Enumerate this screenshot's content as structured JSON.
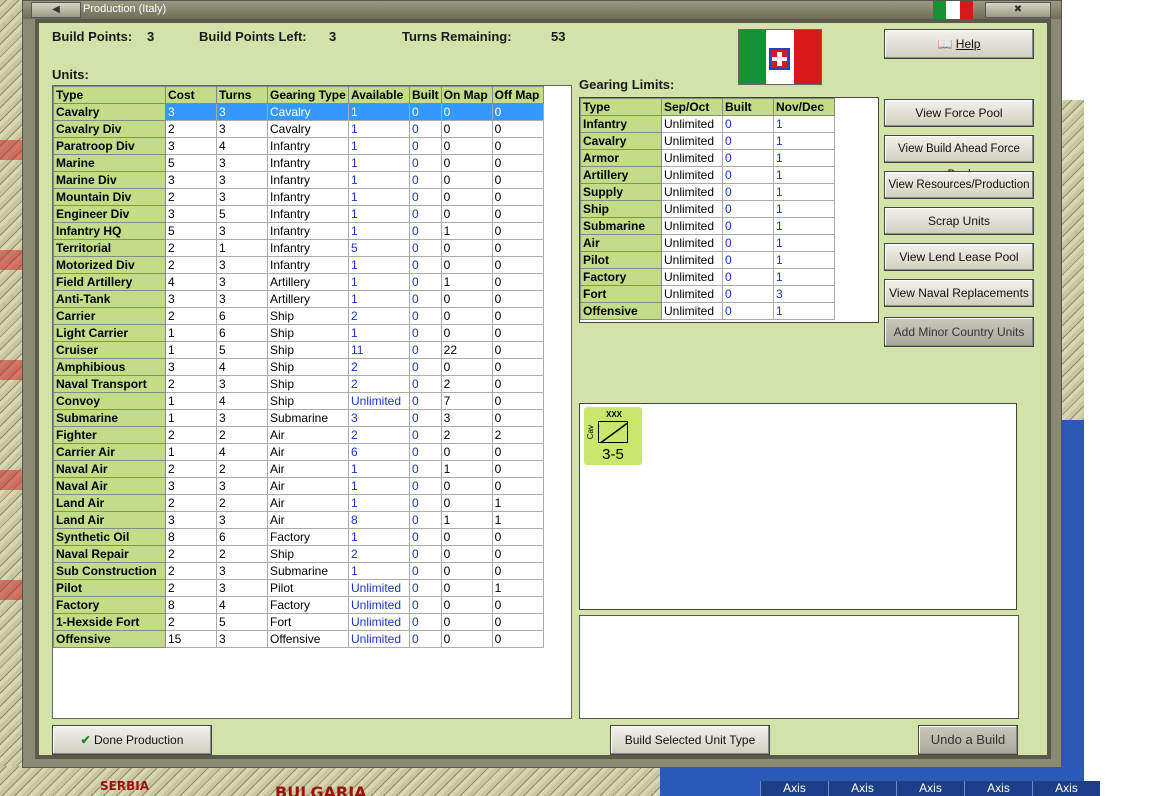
{
  "window": {
    "title": "Production (Italy)"
  },
  "status": {
    "build_points_label": "Build Points:",
    "build_points_value": "3",
    "build_points_left_label": "Build Points Left:",
    "build_points_left_value": "3",
    "turns_remaining_label": "Turns Remaining:",
    "turns_remaining_value": "53"
  },
  "units": {
    "heading": "Units:",
    "columns": [
      "Type",
      "Cost",
      "Turns",
      "Gearing Type",
      "Available",
      "Built",
      "On Map",
      "Off Map"
    ],
    "rows": [
      [
        "Cavalry",
        "3",
        "3",
        "Cavalry",
        "1",
        "0",
        "0",
        "0"
      ],
      [
        "Cavalry Div",
        "2",
        "3",
        "Cavalry",
        "1",
        "0",
        "0",
        "0"
      ],
      [
        "Paratroop Div",
        "3",
        "4",
        "Infantry",
        "1",
        "0",
        "0",
        "0"
      ],
      [
        "Marine",
        "5",
        "3",
        "Infantry",
        "1",
        "0",
        "0",
        "0"
      ],
      [
        "Marine Div",
        "3",
        "3",
        "Infantry",
        "1",
        "0",
        "0",
        "0"
      ],
      [
        "Mountain Div",
        "2",
        "3",
        "Infantry",
        "1",
        "0",
        "0",
        "0"
      ],
      [
        "Engineer Div",
        "3",
        "5",
        "Infantry",
        "1",
        "0",
        "0",
        "0"
      ],
      [
        "Infantry HQ",
        "5",
        "3",
        "Infantry",
        "1",
        "0",
        "1",
        "0"
      ],
      [
        "Territorial",
        "2",
        "1",
        "Infantry",
        "5",
        "0",
        "0",
        "0"
      ],
      [
        "Motorized Div",
        "2",
        "3",
        "Infantry",
        "1",
        "0",
        "0",
        "0"
      ],
      [
        "Field Artillery",
        "4",
        "3",
        "Artillery",
        "1",
        "0",
        "1",
        "0"
      ],
      [
        "Anti-Tank",
        "3",
        "3",
        "Artillery",
        "1",
        "0",
        "0",
        "0"
      ],
      [
        "Carrier",
        "2",
        "6",
        "Ship",
        "2",
        "0",
        "0",
        "0"
      ],
      [
        "Light Carrier",
        "1",
        "6",
        "Ship",
        "1",
        "0",
        "0",
        "0"
      ],
      [
        "Cruiser",
        "1",
        "5",
        "Ship",
        "11",
        "0",
        "22",
        "0"
      ],
      [
        "Amphibious",
        "3",
        "4",
        "Ship",
        "2",
        "0",
        "0",
        "0"
      ],
      [
        "Naval Transport",
        "2",
        "3",
        "Ship",
        "2",
        "0",
        "2",
        "0"
      ],
      [
        "Convoy",
        "1",
        "4",
        "Ship",
        "Unlimited",
        "0",
        "7",
        "0"
      ],
      [
        "Submarine",
        "1",
        "3",
        "Submarine",
        "3",
        "0",
        "3",
        "0"
      ],
      [
        "Fighter",
        "2",
        "2",
        "Air",
        "2",
        "0",
        "2",
        "2"
      ],
      [
        "Carrier Air",
        "1",
        "4",
        "Air",
        "6",
        "0",
        "0",
        "0"
      ],
      [
        "Naval Air",
        "2",
        "2",
        "Air",
        "1",
        "0",
        "1",
        "0"
      ],
      [
        "Naval Air",
        "3",
        "3",
        "Air",
        "1",
        "0",
        "0",
        "0"
      ],
      [
        "Land Air",
        "2",
        "2",
        "Air",
        "1",
        "0",
        "0",
        "1"
      ],
      [
        "Land Air",
        "3",
        "3",
        "Air",
        "8",
        "0",
        "1",
        "1"
      ],
      [
        "Synthetic Oil",
        "8",
        "6",
        "Factory",
        "1",
        "0",
        "0",
        "0"
      ],
      [
        "Naval Repair",
        "2",
        "2",
        "Ship",
        "2",
        "0",
        "0",
        "0"
      ],
      [
        "Sub Construction",
        "2",
        "3",
        "Submarine",
        "1",
        "0",
        "0",
        "0"
      ],
      [
        "Pilot",
        "2",
        "3",
        "Pilot",
        "Unlimited",
        "0",
        "0",
        "1"
      ],
      [
        "Factory",
        "8",
        "4",
        "Factory",
        "Unlimited",
        "0",
        "0",
        "0"
      ],
      [
        "1-Hexside Fort",
        "2",
        "5",
        "Fort",
        "Unlimited",
        "0",
        "0",
        "0"
      ],
      [
        "Offensive",
        "15",
        "3",
        "Offensive",
        "Unlimited",
        "0",
        "0",
        "0"
      ]
    ]
  },
  "gearing": {
    "heading": "Gearing Limits:",
    "columns": [
      "Type",
      "Sep/Oct",
      "Built",
      "Nov/Dec"
    ],
    "rows": [
      [
        "Infantry",
        "Unlimited",
        "0",
        "1"
      ],
      [
        "Cavalry",
        "Unlimited",
        "0",
        "1"
      ],
      [
        "Armor",
        "Unlimited",
        "0",
        "1"
      ],
      [
        "Artillery",
        "Unlimited",
        "0",
        "1"
      ],
      [
        "Supply",
        "Unlimited",
        "0",
        "1"
      ],
      [
        "Ship",
        "Unlimited",
        "0",
        "1"
      ],
      [
        "Submarine",
        "Unlimited",
        "0",
        "1"
      ],
      [
        "Air",
        "Unlimited",
        "0",
        "1"
      ],
      [
        "Pilot",
        "Unlimited",
        "0",
        "1"
      ],
      [
        "Factory",
        "Unlimited",
        "0",
        "1"
      ],
      [
        "Fort",
        "Unlimited",
        "0",
        "3"
      ],
      [
        "Offensive",
        "Unlimited",
        "0",
        "1"
      ]
    ]
  },
  "buttons": {
    "help": "Help",
    "view_force_pool": "View Force Pool",
    "view_build_ahead": "View Build Ahead Force Pool",
    "view_resources": "View Resources/Production",
    "scrap_units": "Scrap Units",
    "view_lend_lease": "View Lend Lease Pool",
    "view_naval_replacements": "View Naval Replacements",
    "add_minor_country": "Add Minor Country Units",
    "done_production": "Done Production",
    "build_selected": "Build Selected Unit Type",
    "undo_build": "Undo a Build"
  },
  "counter": {
    "size": "XXX",
    "type": "Cav",
    "strength": "3-5"
  },
  "map": {
    "labels": [
      "SERBIA",
      "BULGARIA"
    ],
    "axis_buttons": [
      "Axis",
      "Axis",
      "Axis",
      "Axis",
      "Axis"
    ]
  },
  "colors": {
    "header_green": "#c2dc88",
    "panel_bg": "#d2e2a8",
    "selection": "#3399ff",
    "value_blue": "#1a35c8",
    "flag_green": "#149236",
    "flag_red": "#d41a1a"
  },
  "icons": [
    "help-book-icon",
    "checkmark-icon",
    "italy-flag-icon",
    "cavalry-unit-icon"
  ]
}
